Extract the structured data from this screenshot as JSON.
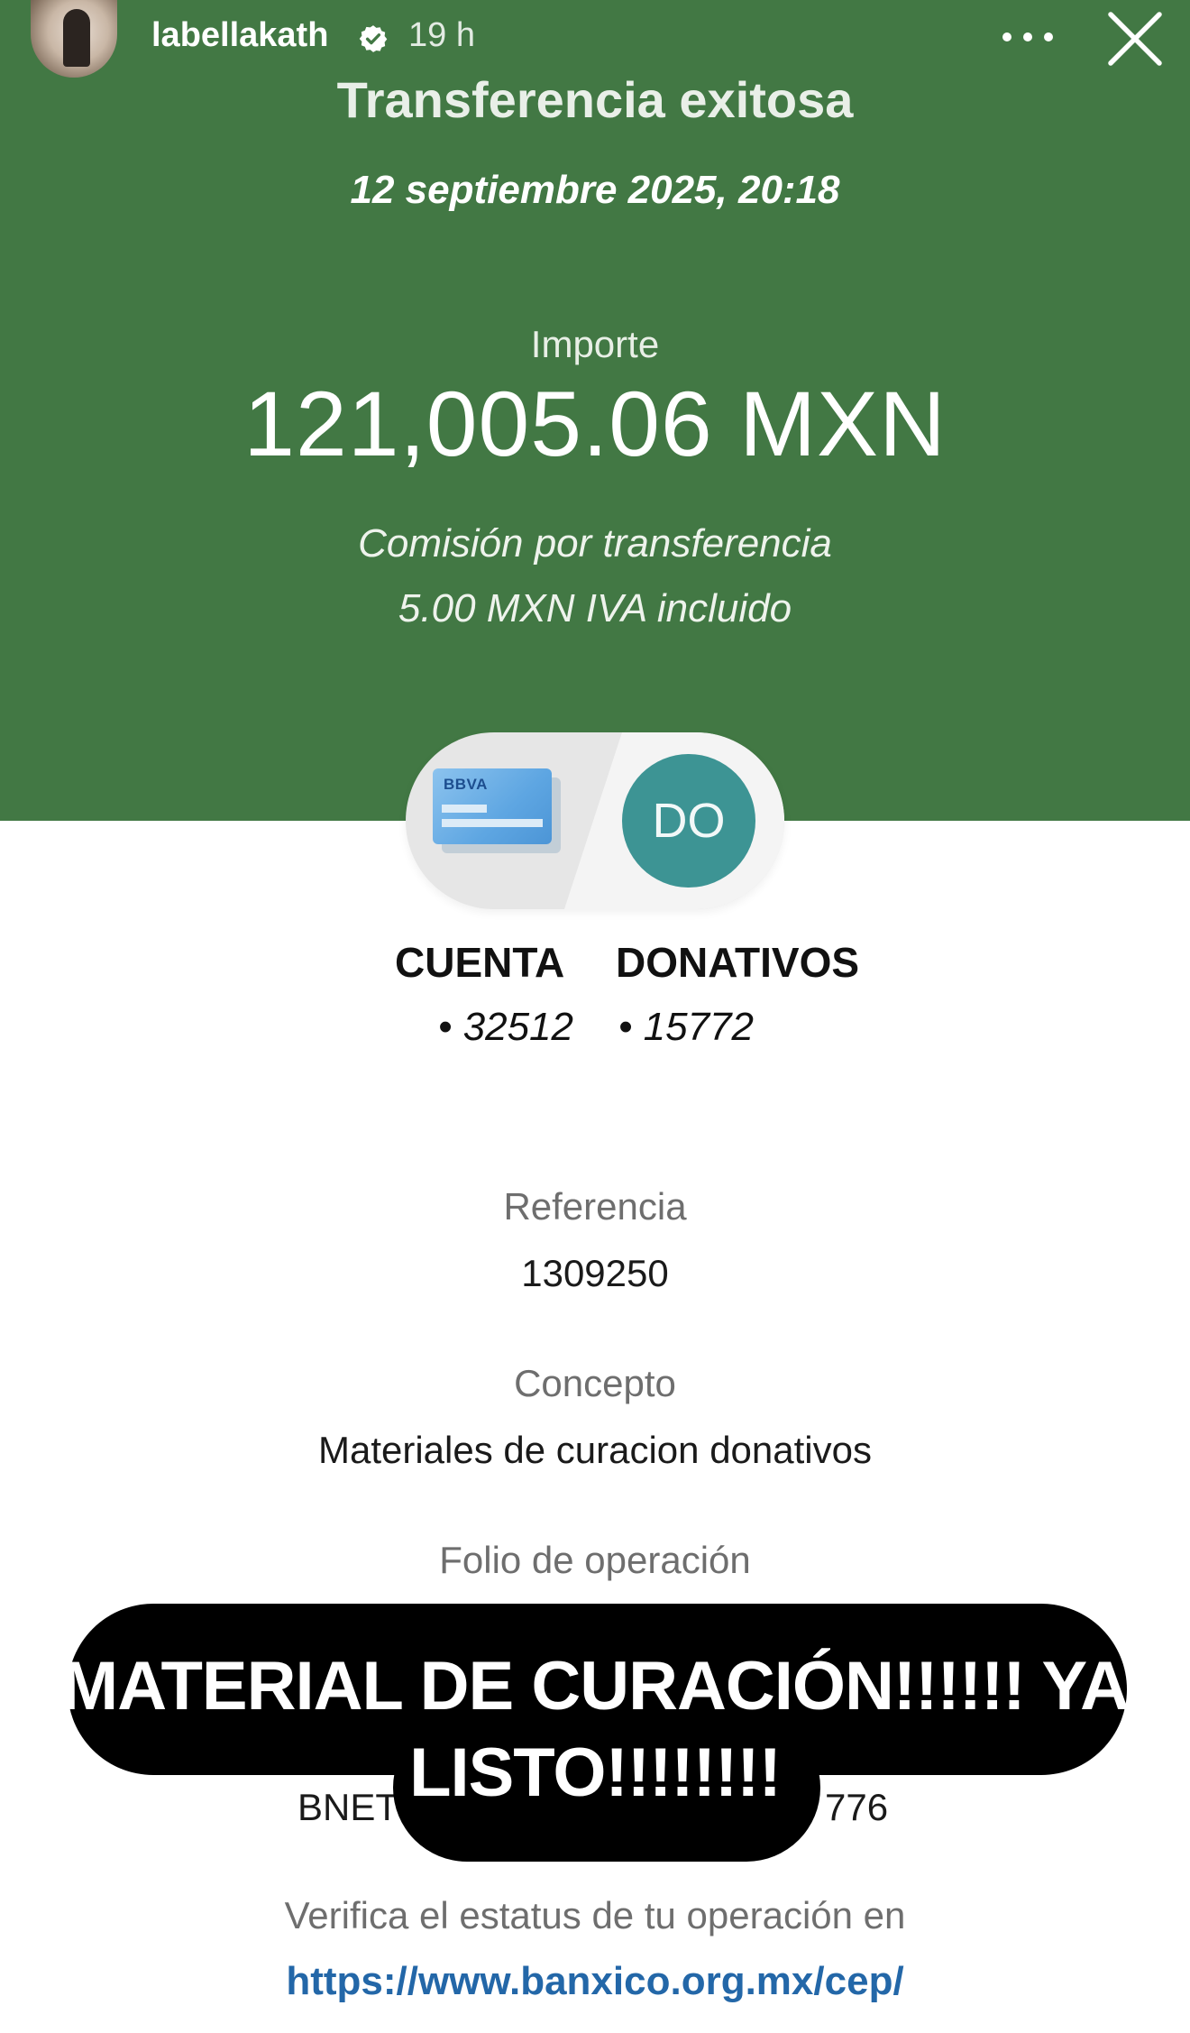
{
  "story": {
    "username": "labellakath",
    "time_ago": "19 h",
    "icons": [
      "verified-badge-icon",
      "more-options-icon",
      "close-icon"
    ]
  },
  "receipt": {
    "title": "Transferencia exitosa",
    "datetime": "12 septiembre 2025, 20:18",
    "amount_label": "Importe",
    "amount": "121,005.06 MXN",
    "fee_label": "Comisión por transferencia",
    "fee_value": "5.00 MXN IVA incluido",
    "header_color": "#427844",
    "origin": {
      "bank_logo": "BBVA",
      "label": "CUENTA",
      "number": "• 32512"
    },
    "destination": {
      "initials": "DO",
      "label": "DONATIVOS",
      "number": "• 15772",
      "avatar_color": "#3d9494"
    },
    "reference_label": "Referencia",
    "reference_value": "1309250",
    "concept_label": "Concepto",
    "concept_value": "Materiales de curacion donativos",
    "folio_label": "Folio de operación",
    "tracking_partial_left": "BNET",
    "tracking_partial_right": "776",
    "verify_text": "Verifica el estatus de tu operación en",
    "verify_link": "https://www.banxico.org.mx/cep/",
    "link_color": "#2367a8"
  },
  "sticker": {
    "line1": "MATERIAL DE CURACIÓN!!!!!! YA",
    "line2": "LISTO!!!!!!!!"
  }
}
